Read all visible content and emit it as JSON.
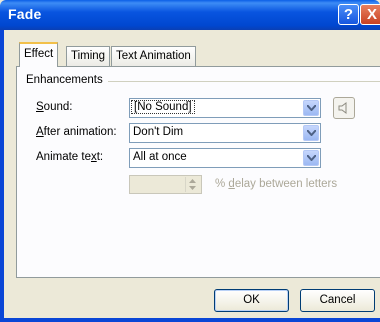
{
  "window": {
    "title": "Fade",
    "help_label": "?",
    "close_label": "X"
  },
  "tabs": [
    {
      "label": "Effect",
      "active": true
    },
    {
      "label": "Timing",
      "active": false
    },
    {
      "label": "Text Animation",
      "active": false
    }
  ],
  "enhancements": {
    "group_label": "Enhancements",
    "sound": {
      "label_prefix": "",
      "label_mnemonic": "S",
      "label_rest": "ound:",
      "value": "[No Sound]"
    },
    "after_animation": {
      "label_prefix": "",
      "label_mnemonic": "A",
      "label_rest": "fter animation:",
      "value": "Don't Dim"
    },
    "animate_text": {
      "label_prefix": "Animate te",
      "label_mnemonic": "x",
      "label_rest": "t:",
      "value": "All at once"
    },
    "delay": {
      "value": "",
      "label_prefix": "% ",
      "label_mnemonic": "d",
      "label_rest": "elay between letters"
    }
  },
  "buttons": {
    "ok": "OK",
    "cancel": "Cancel"
  },
  "icons": [
    "speaker-icon",
    "dropdown-arrow-icon",
    "spin-up-icon",
    "spin-down-icon"
  ]
}
